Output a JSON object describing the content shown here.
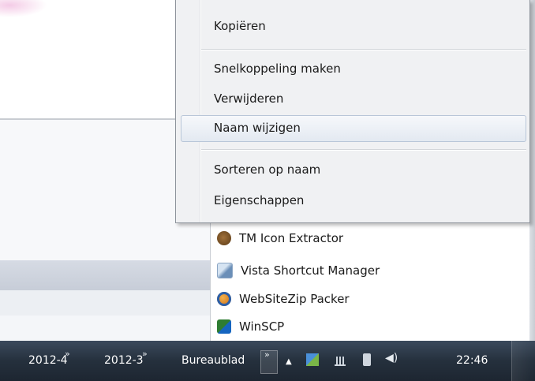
{
  "context_menu": {
    "items": [
      {
        "label": "Kopiëren"
      },
      {
        "label": "Snelkoppeling maken"
      },
      {
        "label": "Verwijderen"
      },
      {
        "label": "Naam wijzigen",
        "highlighted": true
      },
      {
        "label": "Sorteren op naam"
      },
      {
        "label": "Eigenschappen"
      }
    ]
  },
  "program_list": {
    "items": [
      {
        "label": "TM Icon Extractor",
        "icon": "tm-icon-extractor-icon"
      },
      {
        "label": "Vista Shortcut Manager",
        "icon": "vista-shortcut-manager-icon"
      },
      {
        "label": "WebSiteZip Packer",
        "icon": "websitezip-packer-icon"
      },
      {
        "label": "WinSCP",
        "icon": "winscp-icon"
      }
    ]
  },
  "taskbar": {
    "toolbars": [
      {
        "label": "2012-4",
        "chevron": "»"
      },
      {
        "label": "2012-3",
        "chevron": "»"
      },
      {
        "label": "Bureaublad",
        "chevron": "»"
      }
    ],
    "tray_expand": "▲",
    "clock": "22:46"
  },
  "colors": {
    "menu_bg": "#f0f1f3",
    "highlight_border": "#b8c6d8",
    "taskbar_bg": "#25303d"
  }
}
